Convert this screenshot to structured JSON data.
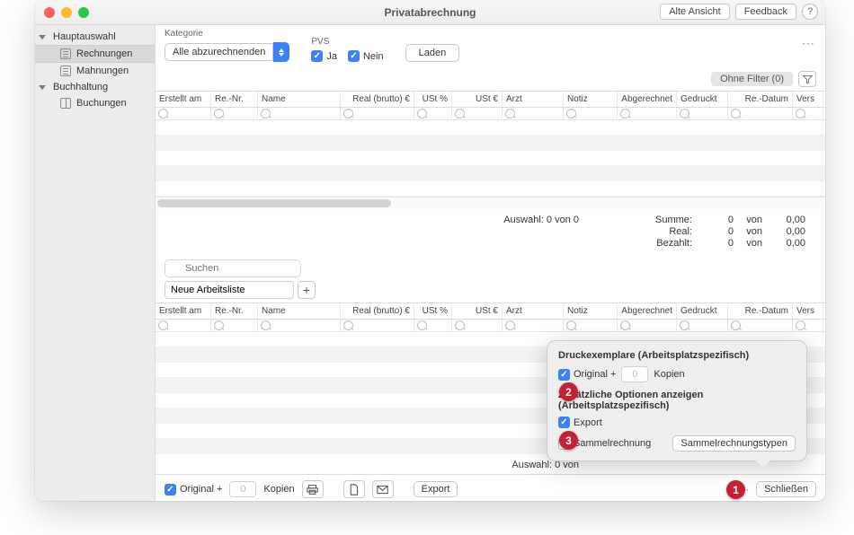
{
  "window_title": "Privatabrechnung",
  "titlebar_buttons": {
    "alte_ansicht": "Alte Ansicht",
    "feedback": "Feedback",
    "help": "?"
  },
  "sidebar": {
    "group1": "Hauptauswahl",
    "item_rechnungen": "Rechnungen",
    "item_mahnungen": "Mahnungen",
    "group2": "Buchhaltung",
    "item_buchungen": "Buchungen"
  },
  "toolbar": {
    "kategorie_label": "Kategorie",
    "kategorie_value": "Alle abzurechnenden",
    "pvs_label": "PVS",
    "pvs_ja": "Ja",
    "pvs_nein": "Nein",
    "laden": "Laden"
  },
  "filter_chip": "Ohne Filter (0)",
  "columns": {
    "erstellt": "Erstellt am",
    "renr": "Re.-Nr.",
    "name": "Name",
    "real": "Real (brutto) €",
    "ust": "USt %",
    "uste": "USt €",
    "arzt": "Arzt",
    "notiz": "Notiz",
    "abg": "Abgerechnet",
    "gedruckt": "Gedruckt",
    "redatum": "Re.-Datum",
    "vers": "Vers"
  },
  "summary": {
    "auswahl": "Auswahl:  0 von 0",
    "summe_l": "Summe:",
    "real_l": "Real:",
    "bezahlt_l": "Bezahlt:",
    "zero": "0",
    "von": "von",
    "v000": "0,00"
  },
  "search_placeholder": "Suchen",
  "worklist_value": "Neue Arbeitsliste",
  "summary2_auswahl": "Auswahl:  0 von",
  "footer": {
    "original": "Original  +",
    "kopien_value": "0",
    "kopien": "Kopien",
    "export": "Export",
    "schliessen": "Schließen"
  },
  "popover": {
    "hdr1": "Druckexemplare (Arbeitsplatzspezifisch)",
    "original": "Original  +",
    "kopien_value": "0",
    "kopien": "Kopien",
    "hdr2": "Zusätzliche Optionen anzeigen (Arbeitsplatzspezifisch)",
    "export": "Export",
    "sammel": "Sammelrechnung",
    "sammel_btn": "Sammelrechnungstypen"
  },
  "callouts": {
    "c1": "1",
    "c2": "2",
    "c3": "3"
  }
}
